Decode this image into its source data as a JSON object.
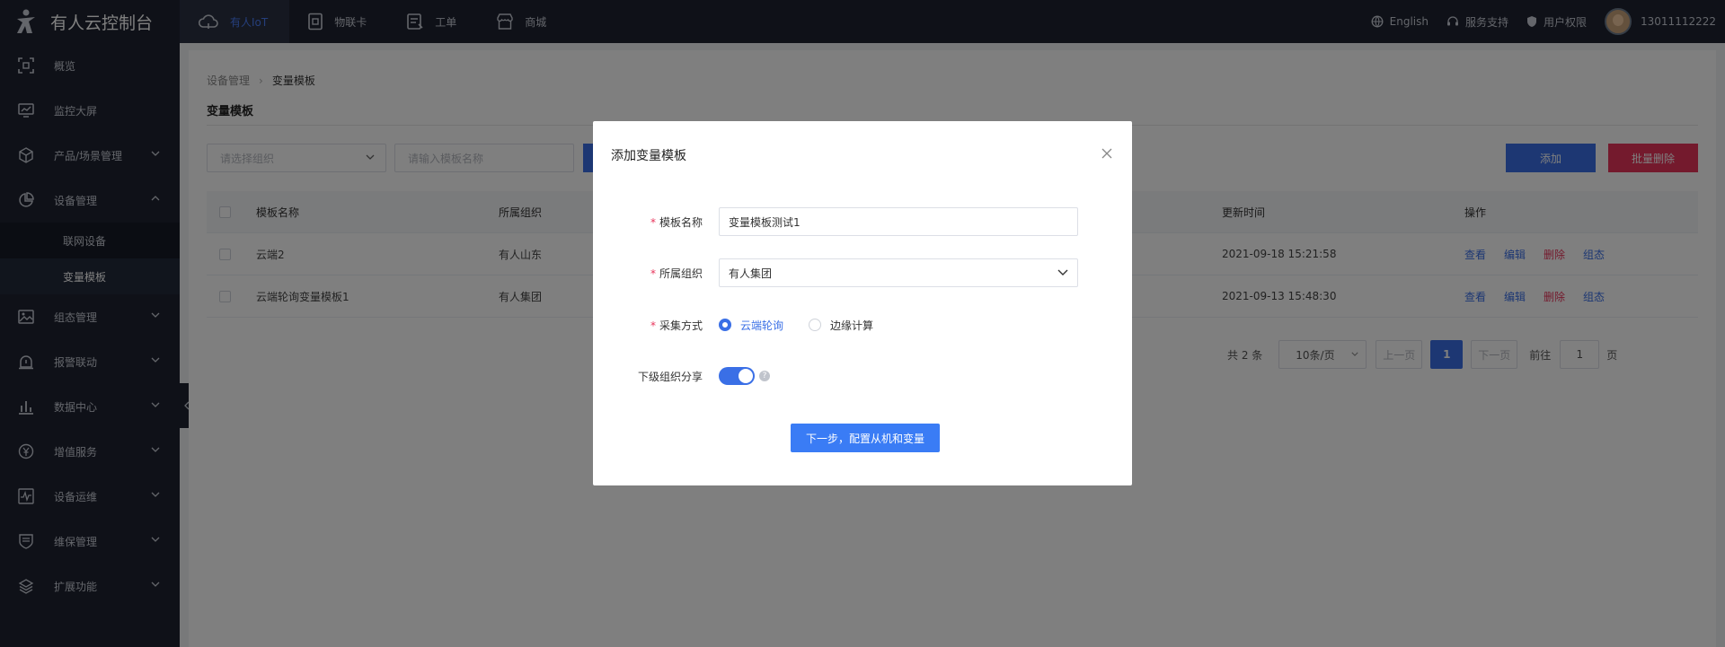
{
  "app": {
    "title": "有人云控制台"
  },
  "topnav": [
    {
      "label": "有人IoT",
      "icon": "cloud-icon",
      "active": true
    },
    {
      "label": "物联卡",
      "icon": "sim-card-icon"
    },
    {
      "label": "工单",
      "icon": "ticket-icon"
    },
    {
      "label": "商城",
      "icon": "store-icon"
    }
  ],
  "topright": {
    "language": "English",
    "support": "服务支持",
    "permissions": "用户权限",
    "user": "13011112222"
  },
  "sidebar": {
    "items": [
      {
        "label": "概览"
      },
      {
        "label": "监控大屏"
      },
      {
        "label": "产品/场景管理"
      },
      {
        "label": "设备管理"
      },
      {
        "label": "组态管理"
      },
      {
        "label": "报警联动"
      },
      {
        "label": "数据中心"
      },
      {
        "label": "增值服务"
      },
      {
        "label": "设备运维"
      },
      {
        "label": "维保管理"
      },
      {
        "label": "扩展功能"
      }
    ],
    "subitems": [
      {
        "label": "联网设备"
      },
      {
        "label": "变量模板"
      }
    ]
  },
  "breadcrumb": {
    "parent": "设备管理",
    "current": "变量模板"
  },
  "page": {
    "title": "变量模板"
  },
  "filters": {
    "org_placeholder": "请选择组织",
    "name_placeholder": "请输入模板名称"
  },
  "actions": {
    "add": "添加",
    "batch_delete": "批量删除"
  },
  "table": {
    "headers": {
      "name": "模板名称",
      "org": "所属组织",
      "time": "更新时间",
      "ops": "操作"
    },
    "rows": [
      {
        "name": "云端2",
        "org": "有人山东",
        "time": "2021-09-18 15:21:58"
      },
      {
        "name": "云端轮询变量模板1",
        "org": "有人集团",
        "time": "2021-09-13 15:48:30"
      }
    ],
    "ops": {
      "view": "查看",
      "edit": "编辑",
      "delete": "删除",
      "config": "组态"
    }
  },
  "pager": {
    "total": "共 2 条",
    "size": "10条/页",
    "prev": "上一页",
    "current": "1",
    "next": "下一页",
    "goto": "前往",
    "goto_value": "1",
    "page_unit": "页"
  },
  "modal": {
    "title": "添加变量模板",
    "fields": {
      "name_label": "模板名称",
      "name_value": "变量模板测试1",
      "org_label": "所属组织",
      "org_value": "有人集团",
      "method_label": "采集方式",
      "method_opt1": "云端轮询",
      "method_opt2": "边缘计算",
      "share_label": "下级组织分享",
      "help": "?"
    },
    "next_button": "下一步，配置从机和变量"
  },
  "colors": {
    "accent": "#3a6fe6",
    "danger": "#e8345b",
    "sidebar_bg": "#1e2330"
  }
}
